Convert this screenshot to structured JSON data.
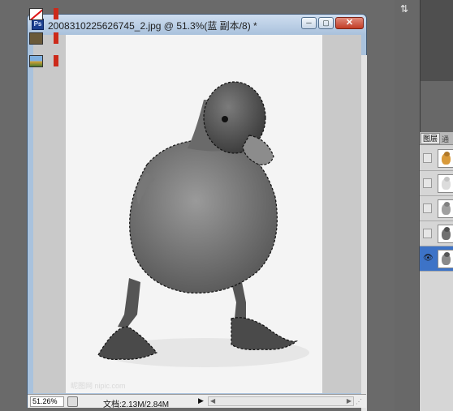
{
  "document": {
    "title": "2008310225626745_2.jpg @ 51.3%(蓝 副本/8) *",
    "app_badge": "Ps",
    "window_buttons": {
      "minimize": "─",
      "maximize": "▢",
      "close": "✕"
    },
    "watermark": "昵图网 nipic.com"
  },
  "status_bar": {
    "zoom": "51.26%",
    "doc_size": "文档:2.13M/2.84M",
    "menu_arrow": "▶",
    "scroll_left": "◀",
    "scroll_right": "▶",
    "resize_grip": "⋰"
  },
  "right_panel": {
    "arrange_icon": "arrange-documents",
    "swatch_colors": {
      "brown": "#6a5a3a",
      "red": "#cc2a1a"
    }
  },
  "layers_panel": {
    "tab_label": "图层",
    "tab2_label": "通",
    "eye_symbol": "👁",
    "layers": [
      {
        "thumb": "color-duck",
        "visible": false,
        "selected": false
      },
      {
        "thumb": "light-duck",
        "visible": false,
        "selected": false
      },
      {
        "thumb": "gray-duck",
        "visible": false,
        "selected": false
      },
      {
        "thumb": "dark-duck",
        "visible": false,
        "selected": false
      },
      {
        "thumb": "selected-duck",
        "visible": true,
        "selected": true
      }
    ]
  },
  "colors": {
    "title_bar": "#a9c1dc",
    "close_button": "#c23c26",
    "selection": "#3d73c7"
  }
}
